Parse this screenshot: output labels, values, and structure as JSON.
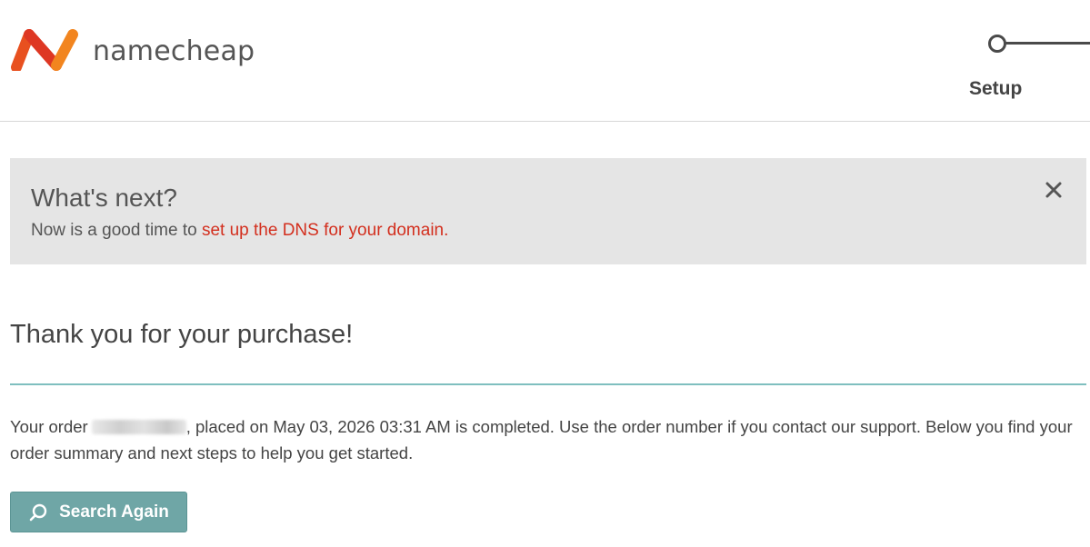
{
  "header": {
    "brand_name": "namecheap",
    "step_label": "Setup",
    "brand_colors": {
      "primary": "#f26b21",
      "secondary": "#de3723"
    }
  },
  "notice": {
    "title": "What's next?",
    "text_prefix": "Now is a good time to ",
    "link_text": "set up the DNS for your domain.",
    "close_icon": "close-icon"
  },
  "main": {
    "heading": "Thank you for your purchase!",
    "order_text_prefix": "Your order",
    "order_text_suffix": ", placed on May 03, 2026 03:31 AM is completed. Use the order number if you contact our support. Below you find your order summary and next steps to help you get started.",
    "search_button_label": "Search Again",
    "search_icon": "search-icon",
    "accent_color": "#6fa6a6"
  }
}
